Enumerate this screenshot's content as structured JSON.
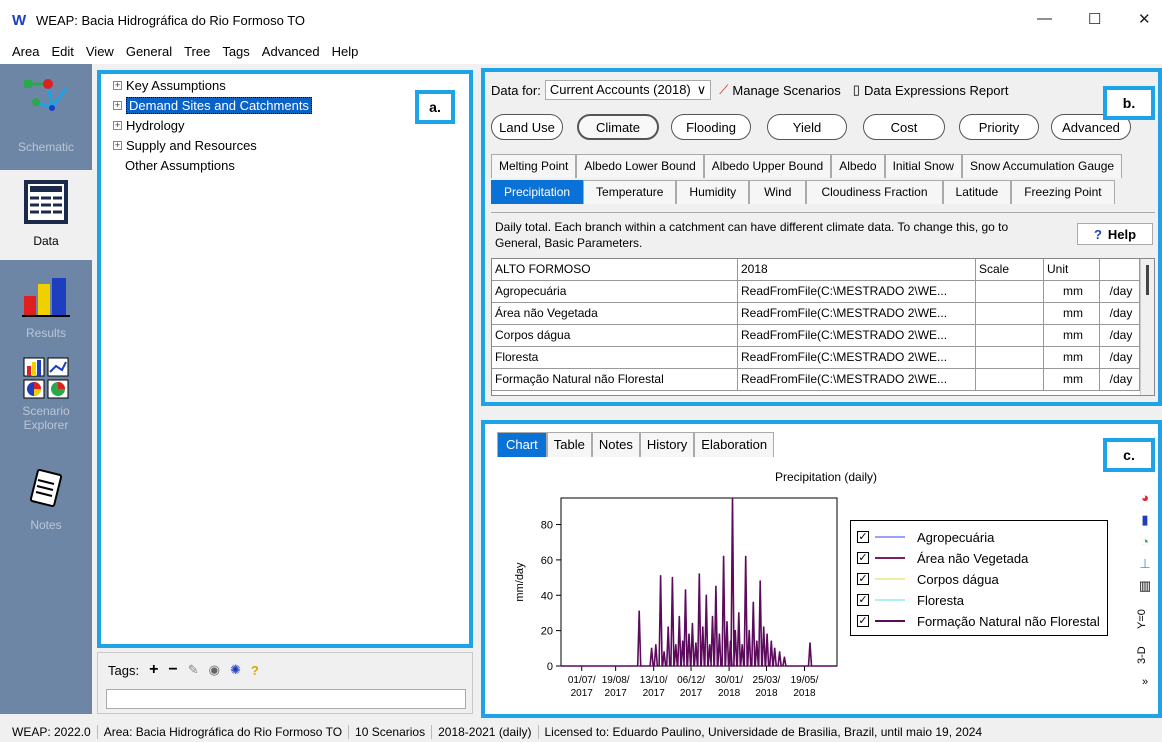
{
  "window": {
    "app_letter": "W",
    "title": "WEAP: Bacia Hidrográfica do Rio Formoso TO",
    "minimize": "—",
    "maximize": "☐",
    "close": "✕"
  },
  "menu": [
    "Area",
    "Edit",
    "View",
    "General",
    "Tree",
    "Tags",
    "Advanced",
    "Help"
  ],
  "sidebar": {
    "items": [
      {
        "label": "Schematic"
      },
      {
        "label": "Data"
      },
      {
        "label": "Results"
      },
      {
        "label": "Scenario Explorer"
      },
      {
        "label": "Notes"
      }
    ]
  },
  "tree": {
    "items": [
      {
        "label": "Key Assumptions",
        "expander": "+"
      },
      {
        "label": "Demand Sites and Catchments",
        "expander": "+"
      },
      {
        "label": "Hydrology",
        "expander": "+"
      },
      {
        "label": "Supply and Resources",
        "expander": "+"
      },
      {
        "label": "Other Assumptions",
        "expander": ""
      }
    ]
  },
  "badges": {
    "a": "a.",
    "b": "b.",
    "c": "c."
  },
  "tags": {
    "label": "Tags:",
    "add": "+",
    "remove": "−",
    "help": "?"
  },
  "data_panel": {
    "data_for_label": "Data for:",
    "scenario": "Current Accounts (2018)",
    "manage_scenarios": "Manage Scenarios",
    "expressions_report": "Data Expressions Report",
    "categories": [
      "Land Use",
      "Climate",
      "Flooding",
      "Yield",
      "Cost",
      "Priority",
      "Advanced"
    ],
    "subtabs_top": [
      "Melting Point",
      "Albedo Lower Bound",
      "Albedo Upper Bound",
      "Albedo",
      "Initial Snow",
      "Snow Accumulation Gauge"
    ],
    "subtabs_bottom": [
      "Precipitation",
      "Temperature",
      "Humidity",
      "Wind",
      "Cloudiness Fraction",
      "Latitude",
      "Freezing Point"
    ],
    "help_text": "Daily total.  Each branch within a catchment can have different climate data.  To change this, go to General, Basic Parameters.",
    "help_button": "Help",
    "table": {
      "headers": [
        "ALTO FORMOSO",
        "2018",
        "Scale",
        "Unit",
        ""
      ],
      "rows": [
        [
          "Agropecuária",
          "ReadFromFile(C:\\MESTRADO 2\\WE...",
          "",
          "mm",
          "/day"
        ],
        [
          "Área não Vegetada",
          "ReadFromFile(C:\\MESTRADO 2\\WE...",
          "",
          "mm",
          "/day"
        ],
        [
          "Corpos dágua",
          "ReadFromFile(C:\\MESTRADO 2\\WE...",
          "",
          "mm",
          "/day"
        ],
        [
          "Floresta",
          "ReadFromFile(C:\\MESTRADO 2\\WE...",
          "",
          "mm",
          "/day"
        ],
        [
          "Formação Natural não Florestal",
          "ReadFromFile(C:\\MESTRADO 2\\WE...",
          "",
          "mm",
          "/day"
        ]
      ]
    }
  },
  "chart_panel": {
    "tabs": [
      "Chart",
      "Table",
      "Notes",
      "History",
      "Elaboration"
    ],
    "tools": [
      "Y=0",
      "3-D"
    ]
  },
  "chart_data": {
    "type": "line",
    "title": "Precipitation (daily)",
    "xlabel": "",
    "ylabel": "mm/day",
    "ylim": [
      0,
      95
    ],
    "yticks": [
      0,
      20,
      40,
      60,
      80
    ],
    "xticks": [
      {
        "date": "2017-07-01",
        "label1": "01/07/",
        "label2": "2017"
      },
      {
        "date": "2017-08-19",
        "label1": "19/08/",
        "label2": "2017"
      },
      {
        "date": "2017-10-13",
        "label1": "13/10/",
        "label2": "2017"
      },
      {
        "date": "2017-12-06",
        "label1": "06/12/",
        "label2": "2017"
      },
      {
        "date": "2018-01-30",
        "label1": "30/01/",
        "label2": "2018"
      },
      {
        "date": "2018-03-25",
        "label1": "25/03/",
        "label2": "2018"
      },
      {
        "date": "2018-05-19",
        "label1": "19/05/",
        "label2": "2018"
      }
    ],
    "xlim": [
      "2017-06-01",
      "2018-07-05"
    ],
    "series": [
      {
        "name": "Agropecuária",
        "color": "#9aa0ff"
      },
      {
        "name": "Área não Vegetada",
        "color": "#7a1f5c"
      },
      {
        "name": "Corpos dágua",
        "color": "#f2ee9e"
      },
      {
        "name": "Floresta",
        "color": "#aef0f0"
      },
      {
        "name": "Formação Natural não Florestal",
        "color": "#5c0a5c"
      }
    ],
    "points": [
      [
        "2017-09-22",
        31
      ],
      [
        "2017-10-10",
        10
      ],
      [
        "2017-10-16",
        12
      ],
      [
        "2017-10-23",
        51
      ],
      [
        "2017-10-28",
        8
      ],
      [
        "2017-11-03",
        22
      ],
      [
        "2017-11-09",
        50
      ],
      [
        "2017-11-14",
        12
      ],
      [
        "2017-11-19",
        28
      ],
      [
        "2017-11-24",
        14
      ],
      [
        "2017-11-28",
        43
      ],
      [
        "2017-12-03",
        18
      ],
      [
        "2017-12-08",
        24
      ],
      [
        "2017-12-13",
        13
      ],
      [
        "2017-12-18",
        52
      ],
      [
        "2017-12-23",
        22
      ],
      [
        "2017-12-28",
        40
      ],
      [
        "2018-01-02",
        12
      ],
      [
        "2018-01-06",
        28
      ],
      [
        "2018-01-11",
        45
      ],
      [
        "2018-01-16",
        18
      ],
      [
        "2018-01-22",
        62
      ],
      [
        "2018-01-27",
        25
      ],
      [
        "2018-02-01",
        14
      ],
      [
        "2018-02-04",
        95
      ],
      [
        "2018-02-08",
        20
      ],
      [
        "2018-02-13",
        30
      ],
      [
        "2018-02-18",
        12
      ],
      [
        "2018-02-23",
        62
      ],
      [
        "2018-02-28",
        20
      ],
      [
        "2018-03-06",
        36
      ],
      [
        "2018-03-11",
        14
      ],
      [
        "2018-03-16",
        48
      ],
      [
        "2018-03-21",
        22
      ],
      [
        "2018-03-26",
        18
      ],
      [
        "2018-04-01",
        14
      ],
      [
        "2018-04-06",
        10
      ],
      [
        "2018-04-13",
        8
      ],
      [
        "2018-04-20",
        5
      ],
      [
        "2018-05-27",
        13
      ]
    ]
  },
  "status": [
    "WEAP: 2022.0",
    "Area: Bacia Hidrográfica do Rio Formoso TO",
    "10 Scenarios",
    "2018-2021 (daily)",
    "Licensed to: Eduardo Paulino, Universidade de Brasilia, Brazil, until maio 19, 2024"
  ]
}
